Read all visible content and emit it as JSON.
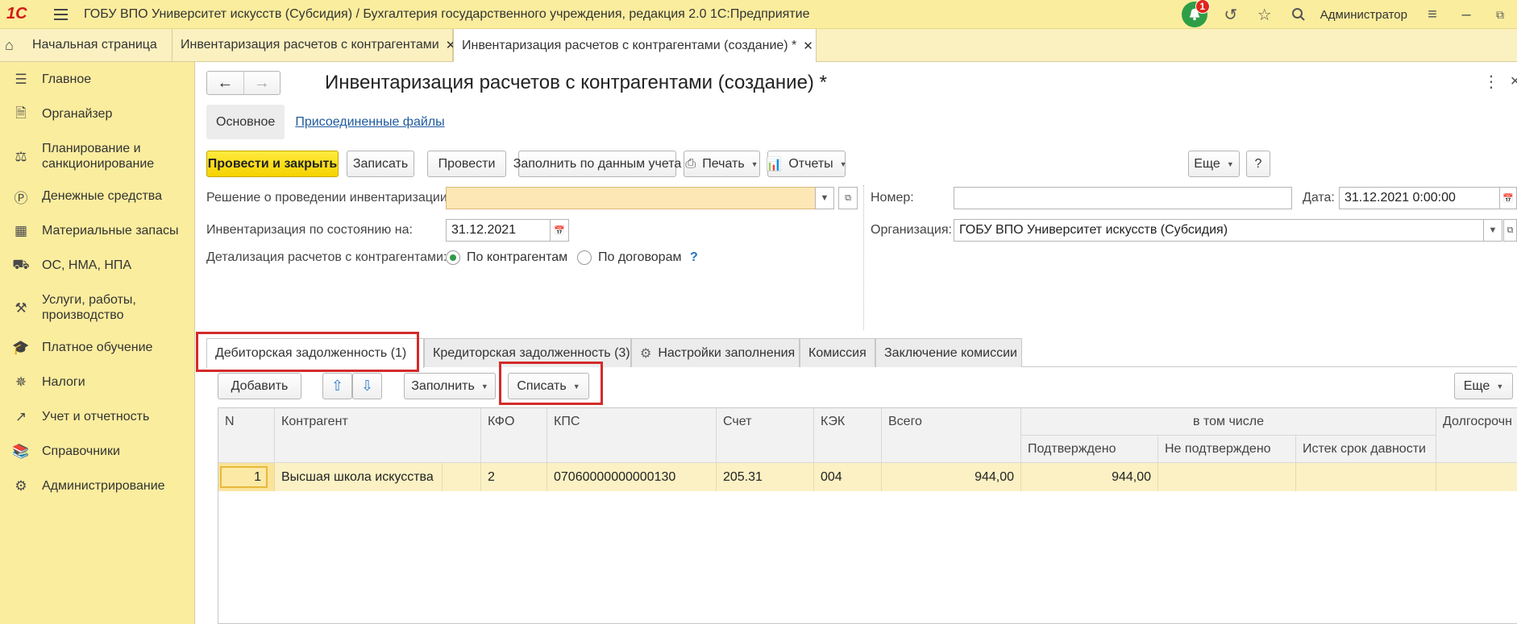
{
  "app": {
    "title": "ГОБУ ВПО Университет искусств (Субсидия) / Бухгалтерия государственного учреждения, редакция 2.0 1С:Предприятие",
    "logo": "1С",
    "notifications_count": "1",
    "user": "Администратор"
  },
  "window_tabs": [
    {
      "label": "Начальная страница"
    },
    {
      "label": "Инвентаризация расчетов с контрагентами"
    },
    {
      "label": "Инвентаризация расчетов с контрагентами (создание) *"
    }
  ],
  "sidebar": {
    "items": [
      {
        "label": "Главное",
        "icon": "menu-lines-icon"
      },
      {
        "label": "Органайзер",
        "icon": "notepad-icon"
      },
      {
        "label": "Планирование и санкционирование",
        "icon": "planning-icon"
      },
      {
        "label": "Денежные средства",
        "icon": "coin-icon"
      },
      {
        "label": "Материальные запасы",
        "icon": "grid-icon"
      },
      {
        "label": "ОС, НМА, НПА",
        "icon": "truck-icon"
      },
      {
        "label": "Услуги, работы, производство",
        "icon": "tools-icon"
      },
      {
        "label": "Платное обучение",
        "icon": "graduation-cap-icon"
      },
      {
        "label": "Налоги",
        "icon": "emblem-icon"
      },
      {
        "label": "Учет и отчетность",
        "icon": "chart-icon"
      },
      {
        "label": "Справочники",
        "icon": "books-icon"
      },
      {
        "label": "Администрирование",
        "icon": "gear-icon"
      }
    ]
  },
  "document": {
    "title": "Инвентаризация расчетов с контрагентами (создание) *",
    "subtabs": {
      "main": "Основное",
      "files": "Присоединенные файлы"
    },
    "toolbar": {
      "post_close": "Провести и закрыть",
      "save": "Записать",
      "post": "Провести",
      "fill_by_accounting": "Заполнить по данным учета",
      "print": "Печать",
      "reports": "Отчеты",
      "more": "Еще",
      "help": "?"
    },
    "fields": {
      "decision_label": "Решение о проведении инвентаризации:",
      "decision_value": "",
      "state_date_label": "Инвентаризация по состоянию на:",
      "state_date_value": "31.12.2021",
      "detail_label": "Детализация расчетов с контрагентами:",
      "detail_opt1": "По контрагентам",
      "detail_opt2": "По договорам",
      "detail_help": "?",
      "number_label": "Номер:",
      "number_value": "",
      "date_label": "Дата:",
      "date_value": "31.12.2021  0:00:00",
      "org_label": "Организация:",
      "org_value": "ГОБУ ВПО Университет искусств (Субсидия)"
    },
    "page_tabs": [
      {
        "label": "Дебиторская задолженность (1)"
      },
      {
        "label": "Кредиторская задолженность (3)"
      },
      {
        "label": "Настройки заполнения"
      },
      {
        "label": "Комиссия"
      },
      {
        "label": "Заключение комиссии"
      }
    ],
    "table_toolbar": {
      "add": "Добавить",
      "fill": "Заполнить",
      "write_off": "Списать",
      "more": "Еще"
    },
    "table": {
      "headers": {
        "n": "N",
        "contractor": "Контрагент",
        "kfo": "КФО",
        "kps": "КПС",
        "account": "Счет",
        "kek": "КЭК",
        "total": "Всего",
        "including": "в том числе",
        "confirmed": "Подтверждено",
        "not_confirmed": "Не подтверждено",
        "expired": "Истек срок давности",
        "longterm": "Долгосрочн"
      },
      "rows": [
        {
          "n": "1",
          "contractor": "Высшая школа искусства",
          "kfo": "2",
          "kps": "07060000000000130",
          "account": "205.31",
          "kek": "004",
          "total": "944,00",
          "confirmed": "944,00",
          "not_confirmed": "",
          "expired": "",
          "longterm": ""
        }
      ]
    }
  },
  "colors": {
    "sidebar_bg": "#fbed9e",
    "primary_button": "#f5d300",
    "highlight_frame": "#d42a2a",
    "selected_row": "#fbf1c4"
  }
}
